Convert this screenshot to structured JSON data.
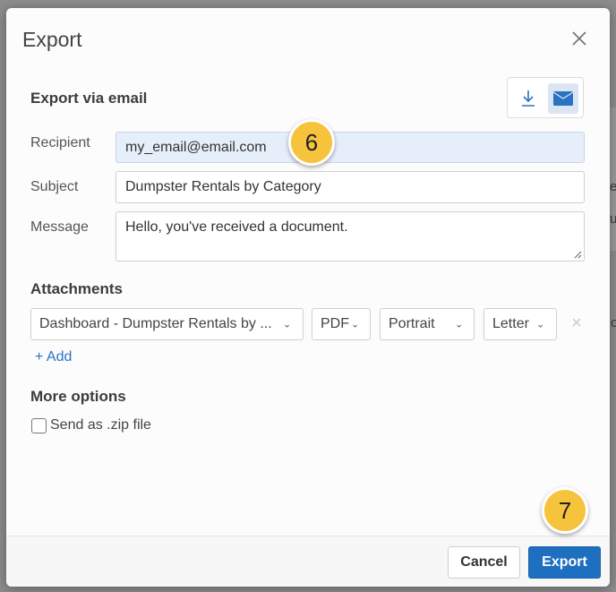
{
  "dialog": {
    "title": "Export",
    "section_title": "Export via email",
    "modes": [
      {
        "icon": "download-icon",
        "active": false
      },
      {
        "icon": "envelope-icon",
        "active": true
      }
    ]
  },
  "form": {
    "recipient_label": "Recipient",
    "recipient_value": "my_email@email.com",
    "subject_label": "Subject",
    "subject_value": "Dumpster Rentals by Category",
    "message_label": "Message",
    "message_value": "Hello, you've received a document."
  },
  "attachments": {
    "title": "Attachments",
    "item": {
      "document": "Dashboard - Dumpster Rentals by ...",
      "format": "PDF",
      "orientation": "Portrait",
      "paper_size": "Letter"
    },
    "add_label": "+ Add"
  },
  "more_options": {
    "title": "More options",
    "zip_label": "Send as .zip file",
    "zip_checked": false
  },
  "footer": {
    "cancel_label": "Cancel",
    "export_label": "Export"
  },
  "step_badges": [
    "6",
    "7"
  ],
  "background_hints": [
    "e",
    "u",
    "o"
  ],
  "colors": {
    "primary": "#1f6fc0",
    "badge": "#f6c33d",
    "focused_field": "#e6eefa"
  }
}
